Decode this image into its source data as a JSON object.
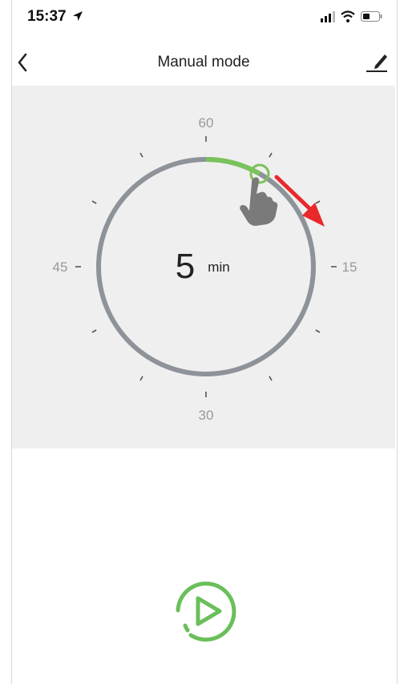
{
  "status_bar": {
    "time": "15:37",
    "icons": [
      "location-arrow-icon",
      "signal-bars-icon",
      "wifi-icon",
      "battery-icon"
    ]
  },
  "nav": {
    "title": "Manual mode",
    "back_icon": "chevron-left-icon",
    "edit_icon": "pencil-icon"
  },
  "dial": {
    "value": "5",
    "unit": "min",
    "max_minutes": 60,
    "selected_minutes": 5,
    "labels": {
      "top": "60",
      "right": "15",
      "bottom": "30",
      "left": "45"
    },
    "colors": {
      "track": "#8e9299",
      "progress": "#7ac25a",
      "annotation_arrow": "#e8282a",
      "hand": "#7a7a7a"
    },
    "annotation_icons": [
      "hand-pointer-icon",
      "red-arrow-icon"
    ]
  },
  "play": {
    "icon": "play-icon",
    "color": "#6abf5a"
  }
}
